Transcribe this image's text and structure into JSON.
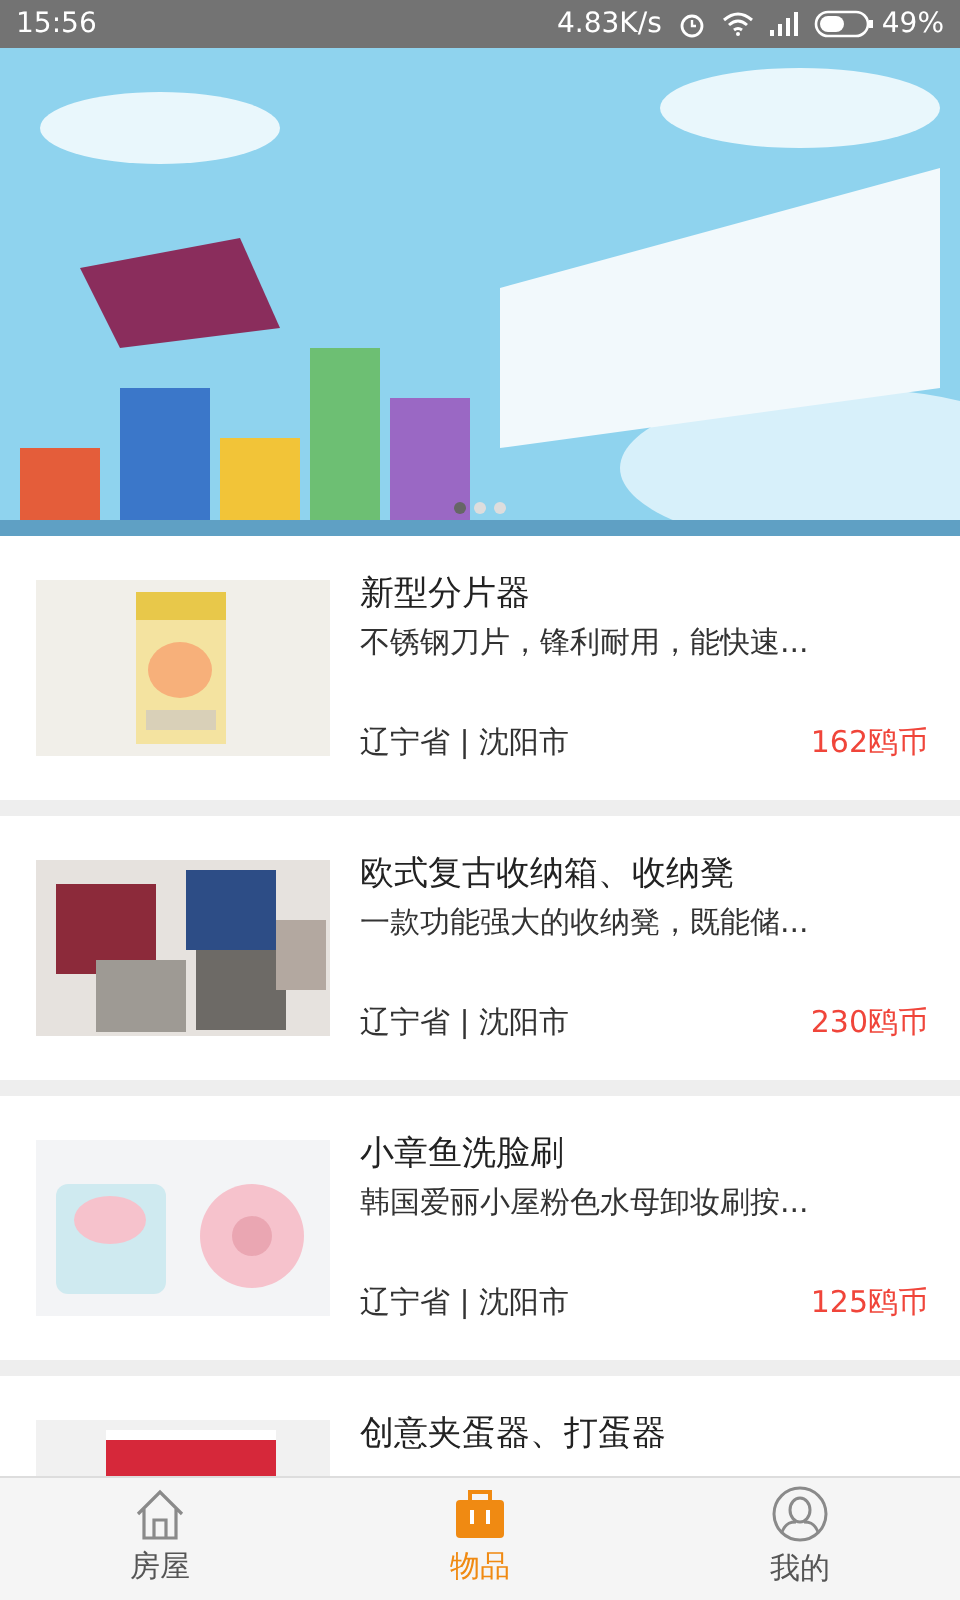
{
  "status_bar": {
    "time": "15:56",
    "speed": "4.83K/s",
    "battery": "49%"
  },
  "banner": {
    "dots": [
      {
        "selected": true
      },
      {
        "selected": false
      },
      {
        "selected": false
      }
    ]
  },
  "items": [
    {
      "title": "新型分片器",
      "description": "不锈钢刀片，锋利耐用，能快速...",
      "location": "辽宁省 | 沈阳市",
      "price": "162鸥币"
    },
    {
      "title": "欧式复古收纳箱、收纳凳",
      "description": "一款功能强大的收纳凳，既能储...",
      "location": "辽宁省 | 沈阳市",
      "price": "230鸥币"
    },
    {
      "title": "小章鱼洗脸刷",
      "description": "韩国爱丽小屋粉色水母卸妆刷按...",
      "location": "辽宁省 | 沈阳市",
      "price": "125鸥币"
    },
    {
      "title": "创意夹蛋器、打蛋器"
    }
  ],
  "tabs": [
    {
      "label": "房屋",
      "selected": false
    },
    {
      "label": "物品",
      "selected": true
    },
    {
      "label": "我的",
      "selected": false
    }
  ]
}
